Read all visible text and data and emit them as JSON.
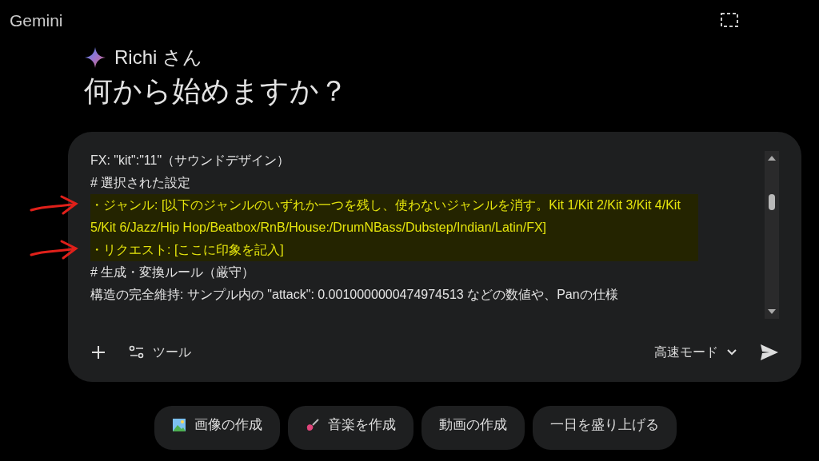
{
  "app_title": "Gemini",
  "greeting": {
    "name": "Richi さん",
    "question": "何から始めますか？"
  },
  "prompt": {
    "lines": [
      {
        "text": "FX: \"kit\":\"11\"（サウンドデザイン）",
        "highlighted": false,
        "arrow": false
      },
      {
        "text": "# 選択された設定",
        "highlighted": false,
        "arrow": false
      },
      {
        "text": "・ジャンル: [以下のジャンルのいずれか一つを残し、使わないジャンルを消す。Kit 1/Kit 2/Kit 3/Kit 4/Kit 5/Kit 6/Jazz/Hip Hop/Beatbox/RnB/House:/DrumNBass/Dubstep/Indian/Latin/FX]",
        "highlighted": true,
        "arrow": true
      },
      {
        "text": "・リクエスト: [ここに印象を記入]",
        "highlighted": true,
        "arrow": true
      },
      {
        "text": "# 生成・変換ルール（厳守）",
        "highlighted": false,
        "arrow": false
      },
      {
        "text": "構造の完全維持: サンプル内の \"attack\": 0.0010000000474974513 などの数値や、Panの仕様",
        "highlighted": false,
        "arrow": false
      }
    ],
    "tools_label": "ツール",
    "mode": "高速モード"
  },
  "chips": [
    {
      "label": "画像の作成",
      "kind": "image"
    },
    {
      "label": "音楽を作成",
      "kind": "music"
    },
    {
      "label": "動画の作成",
      "kind": "none"
    },
    {
      "label": "一日を盛り上げる",
      "kind": "none"
    }
  ]
}
